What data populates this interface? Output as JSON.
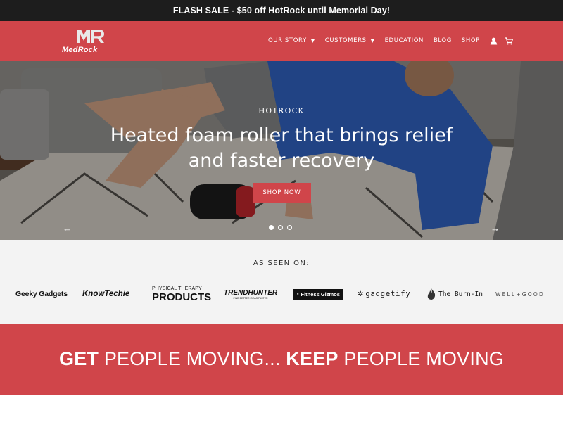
{
  "flash": {
    "text": "FLASH SALE - $50 off HotRock until Memorial Day!"
  },
  "header": {
    "logo_mark": "MR",
    "logo_text": "MedRock",
    "nav": [
      {
        "label": "OUR STORY",
        "caret": "▼"
      },
      {
        "label": "CUSTOMERS",
        "caret": "▼"
      },
      {
        "label": "EDUCATION"
      },
      {
        "label": "BLOG"
      },
      {
        "label": "SHOP"
      }
    ],
    "icons": [
      "user-icon",
      "cart-icon"
    ]
  },
  "hero": {
    "kicker": "HOTROCK",
    "title": "Heated foam roller that brings relief and faster recovery",
    "button": "SHOP NOW",
    "prev": "←",
    "next": "→",
    "slides": 3,
    "active_slide": 1
  },
  "as_seen_on": {
    "title": "AS SEEN ON:",
    "logos": [
      {
        "name": "Geeky Gadgets",
        "text": "Geeky Gadgets"
      },
      {
        "name": "KnowTechie",
        "text": "KnowTechie"
      },
      {
        "name": "Physical Therapy Products",
        "text_top": "PHYSICAL THERAPY",
        "text_bottom": "PRODUCTS"
      },
      {
        "name": "TrendHunter",
        "text": "TRENDHUNTER",
        "sub": "FIND BETTER IDEAS FASTER"
      },
      {
        "name": "Fitness Gizmos",
        "text": "Fitness Gizmos"
      },
      {
        "name": "gadgetify",
        "text": "gadgetify"
      },
      {
        "name": "The Burn-In",
        "text": "The Burn-In"
      },
      {
        "name": "Well+Good",
        "text": "WELL+GOOD"
      }
    ]
  },
  "cta": {
    "word1": "GET",
    "text1": " PEOPLE MOVING... ",
    "word2": "KEEP",
    "text2": " PEOPLE MOVING"
  },
  "colors": {
    "brand_red": "#d0454a",
    "topbar": "#1d1d1d",
    "seen_bg": "#f3f3f3"
  }
}
